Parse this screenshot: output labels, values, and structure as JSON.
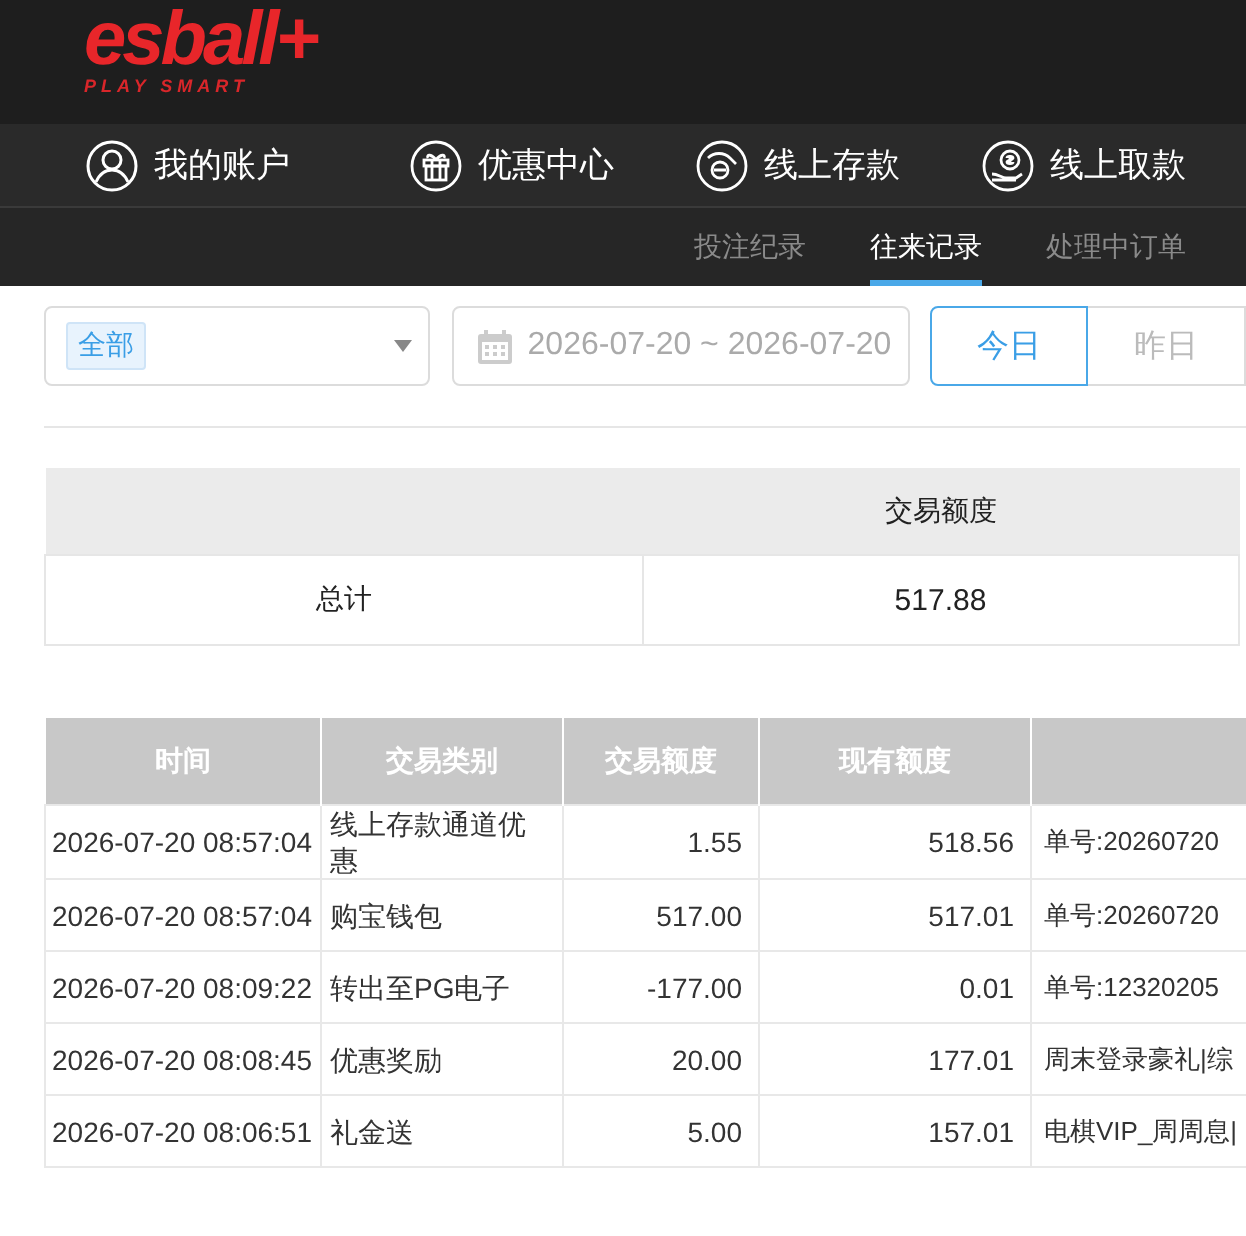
{
  "logo": {
    "wordmark": "esball+",
    "tagline": "PLAY SMART"
  },
  "nav": [
    {
      "label": "我的账户",
      "kind": "user"
    },
    {
      "label": "优惠中心",
      "kind": "gift"
    },
    {
      "label": "线上存款",
      "kind": "deposit"
    },
    {
      "label": "线上取款",
      "kind": "withdraw"
    }
  ],
  "subtabs": [
    {
      "label": "投注纪录",
      "selected": false
    },
    {
      "label": "往来记录",
      "selected": true
    },
    {
      "label": "处理中订单",
      "selected": false
    }
  ],
  "filters": {
    "type_tag": "全部",
    "date_range": "2026-07-20 ~ 2026-07-20",
    "quick_dates": [
      {
        "label": "今日",
        "selected": true
      },
      {
        "label": "昨日",
        "selected": false
      }
    ]
  },
  "summary": {
    "amount_heading": "交易额度",
    "rows": [
      {
        "label": "总计",
        "amount": "517.88"
      }
    ]
  },
  "transactions": {
    "columns": [
      "时间",
      "交易类别",
      "交易额度",
      "现有额度"
    ],
    "rows": [
      {
        "time": "2026-07-20 08:57:04",
        "category": "线上存款通道优惠",
        "amount": "1.55",
        "balance": "518.56",
        "note": "单号:20260720"
      },
      {
        "time": "2026-07-20 08:57:04",
        "category": "购宝钱包",
        "amount": "517.00",
        "balance": "517.01",
        "note": "单号:20260720"
      },
      {
        "time": "2026-07-20 08:09:22",
        "category": "转出至PG电子",
        "amount": "-177.00",
        "balance": "0.01",
        "note": "单号:12320205"
      },
      {
        "time": "2026-07-20 08:08:45",
        "category": "优惠奖励",
        "amount": "20.00",
        "balance": "177.01",
        "note": "周末登录豪礼|综"
      },
      {
        "time": "2026-07-20 08:06:51",
        "category": "礼金送",
        "amount": "5.00",
        "balance": "157.01",
        "note": "电棋VIP_周周息|"
      }
    ]
  }
}
